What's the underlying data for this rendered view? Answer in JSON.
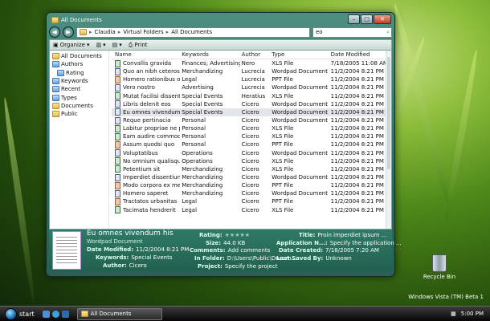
{
  "window": {
    "title": "All Documents",
    "breadcrumb": [
      "Claudia",
      "Virtual Folders",
      "All Documents"
    ],
    "search_value": "eo"
  },
  "toolbar": {
    "organize": "Organize",
    "print": "Print"
  },
  "nav": [
    {
      "label": "All Documents",
      "sub": false,
      "color": "yellow"
    },
    {
      "label": "Authors",
      "sub": false,
      "color": "blue"
    },
    {
      "label": "Rating",
      "sub": true,
      "color": "blue"
    },
    {
      "label": "Keywords",
      "sub": false,
      "color": "blue"
    },
    {
      "label": "Recent",
      "sub": false,
      "color": "blue"
    },
    {
      "label": "Types",
      "sub": false,
      "color": "blue"
    },
    {
      "label": "Documents",
      "sub": false,
      "color": "yellow"
    },
    {
      "label": "Public",
      "sub": false,
      "color": "yellow"
    }
  ],
  "columns": [
    "Name",
    "Keywords",
    "Author",
    "Type",
    "Date Modified"
  ],
  "rows": [
    {
      "name": "Convallis gravida",
      "keywords": "Finances; Advertising",
      "author": "Nero",
      "type": "XLS File",
      "date": "7/18/2005 11:08 AM"
    },
    {
      "name": "Quo an nibh ceteros",
      "keywords": "Merchandizing",
      "author": "Lucrecia",
      "type": "Wordpad Document",
      "date": "11/2/2004 8:21 PM"
    },
    {
      "name": "Homero rationibus omi...",
      "keywords": "Legal",
      "author": "Lucrecia",
      "type": "PPT File",
      "date": "11/2/2004 8:21 PM"
    },
    {
      "name": "Vero nostro",
      "keywords": "Advertising",
      "author": "Lucrecia",
      "type": "Wordpad Document",
      "date": "11/2/2004 8:21 PM"
    },
    {
      "name": "Mutat facilisi dissentiunt",
      "keywords": "Special Events",
      "author": "Heratius",
      "type": "XLS File",
      "date": "11/2/2004 8:21 PM"
    },
    {
      "name": "Libris delenit eos",
      "keywords": "Special Events",
      "author": "Cicero",
      "type": "Wordpad Document",
      "date": "11/2/2004 8:21 PM"
    },
    {
      "name": "Eu omnes vivendum his",
      "keywords": "Special Events",
      "author": "Cicero",
      "type": "Wordpad Document",
      "date": "11/2/2004 8:21 PM"
    },
    {
      "name": "Reque pertinacia",
      "keywords": "Personal",
      "author": "Cicero",
      "type": "Wordpad Document",
      "date": "11/2/2004 8:21 PM"
    },
    {
      "name": "Labitur propriae ne per",
      "keywords": "Personal",
      "author": "Cicero",
      "type": "XLS File",
      "date": "11/2/2004 8:21 PM"
    },
    {
      "name": "Eam audire commodo",
      "keywords": "Personal",
      "author": "Cicero",
      "type": "XLS File",
      "date": "11/2/2004 8:21 PM"
    },
    {
      "name": "Assum quodsi quo",
      "keywords": "Personal",
      "author": "Cicero",
      "type": "PPT File",
      "date": "11/2/2004 8:21 PM"
    },
    {
      "name": "Voluptatibus",
      "keywords": "Operations",
      "author": "Cicero",
      "type": "Wordpad Document",
      "date": "11/2/2004 8:21 PM"
    },
    {
      "name": "No omnium qualisque ...",
      "keywords": "Operations",
      "author": "Cicero",
      "type": "XLS File",
      "date": "11/2/2004 8:21 PM"
    },
    {
      "name": "Petentium sit",
      "keywords": "Merchandizing",
      "author": "Cicero",
      "type": "XLS File",
      "date": "11/2/2004 8:21 PM"
    },
    {
      "name": "Imperdiet dissentiunt",
      "keywords": "Merchandizing",
      "author": "Cicero",
      "type": "Wordpad Document",
      "date": "11/2/2004 8:21 PM"
    },
    {
      "name": "Modo corpora ex mei",
      "keywords": "Merchandizing",
      "author": "Cicero",
      "type": "PPT File",
      "date": "11/2/2004 8:21 PM"
    },
    {
      "name": "Homero saperet",
      "keywords": "Merchandizing",
      "author": "Cicero",
      "type": "Wordpad Document",
      "date": "11/2/2004 8:21 PM"
    },
    {
      "name": "Tractatos urbanitas",
      "keywords": "Legal",
      "author": "Cicero",
      "type": "PPT File",
      "date": "11/2/2004 8:21 PM"
    },
    {
      "name": "Tacimata hendrerit",
      "keywords": "Legal",
      "author": "Cicero",
      "type": "XLS File",
      "date": "11/2/2004 8:21 PM"
    }
  ],
  "selected_index": 6,
  "details": {
    "name": "Eu omnes vivendum his",
    "type": "Wordpad Document",
    "date_modified_label": "Date Modified:",
    "date_modified": "11/2/2004 8:21 PM",
    "keywords_label": "Keywords:",
    "keywords": "Special Events",
    "author_label": "Author:",
    "author": "Cicero",
    "rating_label": "Rating:",
    "rating_stars": "★★★★★",
    "size_label": "Size:",
    "size": "44.0 KB",
    "comments_label": "Comments:",
    "comments": "Add comments",
    "in_folder_label": "In Folder:",
    "in_folder": "D:\\Users\\Public\\Docum...",
    "project_label": "Project:",
    "project": "Specify the project",
    "title_label": "Title:",
    "title": "Proin imperdiet ipsum ...",
    "application_label": "Application N...:",
    "application": "Specify the application ...",
    "date_created_label": "Date Created:",
    "date_created": "7/18/2005 7:20 AM",
    "last_saved_label": "Last Saved By:",
    "last_saved": "Unknown"
  },
  "desktop": {
    "recycle_bin": "Recycle Bin",
    "os_label": "Windows Vista (TM) Beta 1"
  },
  "taskbar": {
    "start": "start",
    "task": "All Documents",
    "clock": "5:00 PM"
  }
}
